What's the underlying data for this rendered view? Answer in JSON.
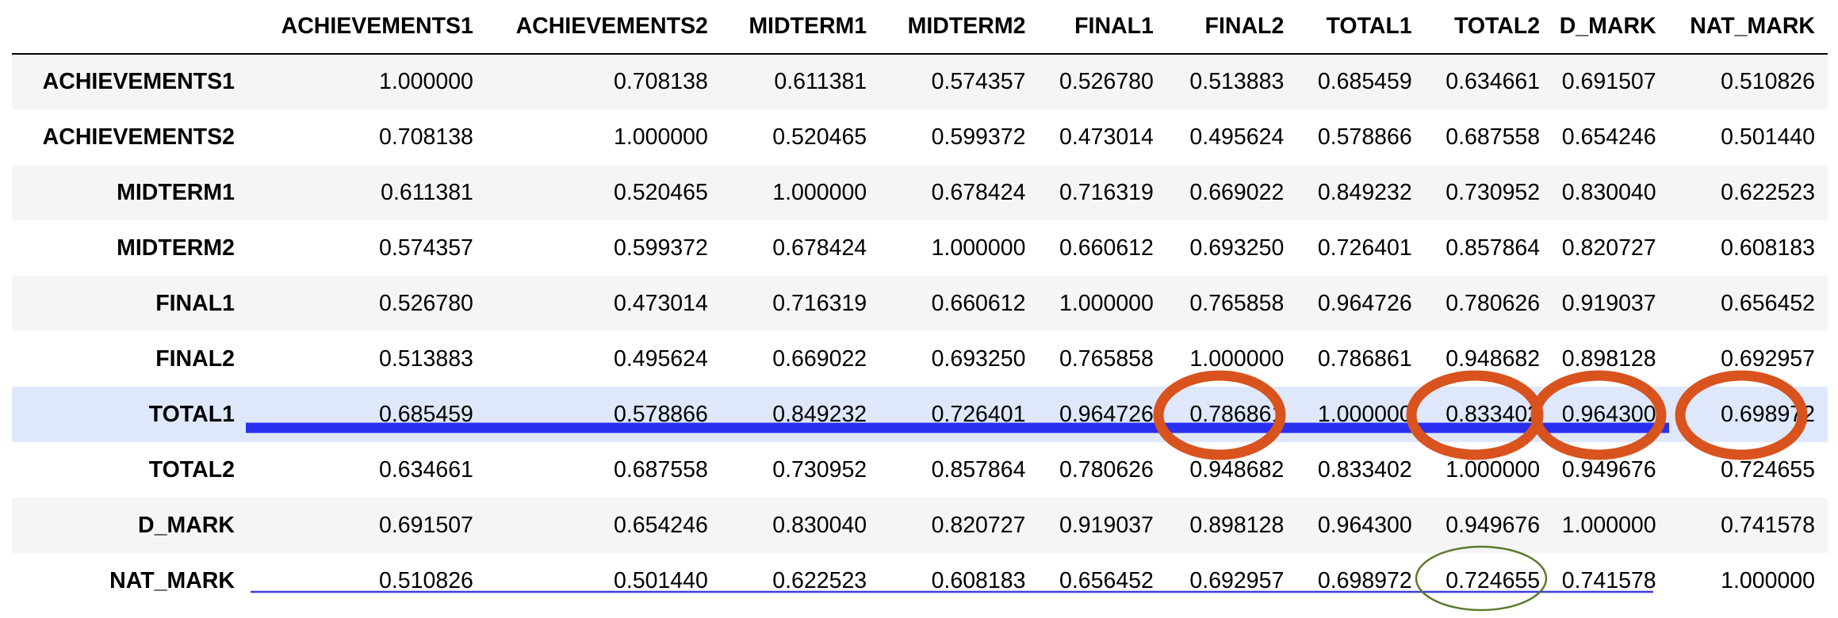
{
  "table": {
    "columns": [
      "ACHIEVEMENTS1",
      "ACHIEVEMENTS2",
      "MIDTERM1",
      "MIDTERM2",
      "FINAL1",
      "FINAL2",
      "TOTAL1",
      "TOTAL2",
      "D_MARK",
      "NAT_MARK"
    ],
    "rows": [
      {
        "label": "ACHIEVEMENTS1",
        "values": [
          "1.000000",
          "0.708138",
          "0.611381",
          "0.574357",
          "0.526780",
          "0.513883",
          "0.685459",
          "0.634661",
          "0.691507",
          "0.510826"
        ]
      },
      {
        "label": "ACHIEVEMENTS2",
        "values": [
          "0.708138",
          "1.000000",
          "0.520465",
          "0.599372",
          "0.473014",
          "0.495624",
          "0.578866",
          "0.687558",
          "0.654246",
          "0.501440"
        ]
      },
      {
        "label": "MIDTERM1",
        "values": [
          "0.611381",
          "0.520465",
          "1.000000",
          "0.678424",
          "0.716319",
          "0.669022",
          "0.849232",
          "0.730952",
          "0.830040",
          "0.622523"
        ]
      },
      {
        "label": "MIDTERM2",
        "values": [
          "0.574357",
          "0.599372",
          "0.678424",
          "1.000000",
          "0.660612",
          "0.693250",
          "0.726401",
          "0.857864",
          "0.820727",
          "0.608183"
        ]
      },
      {
        "label": "FINAL1",
        "values": [
          "0.526780",
          "0.473014",
          "0.716319",
          "0.660612",
          "1.000000",
          "0.765858",
          "0.964726",
          "0.780626",
          "0.919037",
          "0.656452"
        ]
      },
      {
        "label": "FINAL2",
        "values": [
          "0.513883",
          "0.495624",
          "0.669022",
          "0.693250",
          "0.765858",
          "1.000000",
          "0.786861",
          "0.948682",
          "0.898128",
          "0.692957"
        ]
      },
      {
        "label": "TOTAL1",
        "values": [
          "0.685459",
          "0.578866",
          "0.849232",
          "0.726401",
          "0.964726",
          "0.786861",
          "1.000000",
          "0.833402",
          "0.964300",
          "0.698972"
        ]
      },
      {
        "label": "TOTAL2",
        "values": [
          "0.634661",
          "0.687558",
          "0.730952",
          "0.857864",
          "0.780626",
          "0.948682",
          "0.833402",
          "1.000000",
          "0.949676",
          "0.724655"
        ]
      },
      {
        "label": "D_MARK",
        "values": [
          "0.691507",
          "0.654246",
          "0.830040",
          "0.820727",
          "0.919037",
          "0.898128",
          "0.964300",
          "0.949676",
          "1.000000",
          "0.741578"
        ]
      },
      {
        "label": "NAT_MARK",
        "values": [
          "0.510826",
          "0.501440",
          "0.622523",
          "0.608183",
          "0.656452",
          "0.692957",
          "0.698972",
          "0.724655",
          "0.741578",
          "1.000000"
        ]
      }
    ],
    "highlighted_row": "TOTAL1"
  },
  "annotations": {
    "thick_underline_color": "#2b2ff0",
    "thin_underline_color": "#3a3fd8",
    "circle_color": "#d9531e",
    "small_circle_color": "#5b7a2e",
    "row_highlight_color": "#dfe8fb"
  }
}
